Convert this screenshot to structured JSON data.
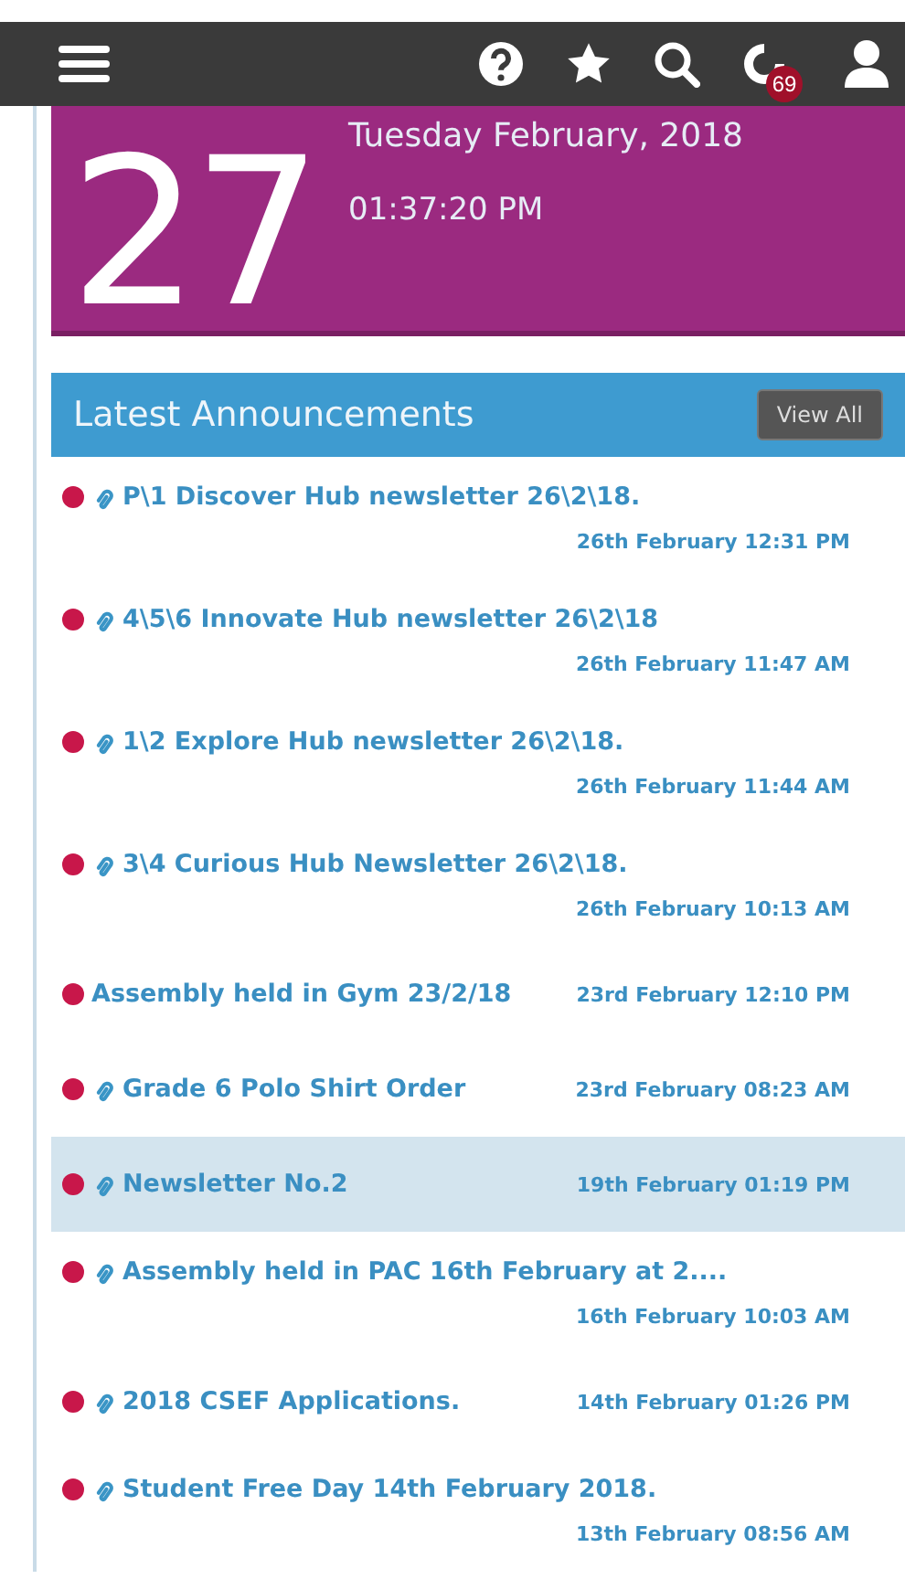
{
  "top_bar": {
    "notification_count": "69"
  },
  "date_card": {
    "day": "27",
    "date": "Tuesday February, 2018",
    "time": "01:37:20 PM"
  },
  "announcements": {
    "title": "Latest Announcements",
    "view_all": "View All",
    "items": [
      {
        "title": "P\\1 Discover Hub newsletter 26\\2\\18.",
        "date": "26th February 12:31 PM",
        "attachment": true,
        "selected": false
      },
      {
        "title": "4\\5\\6 Innovate Hub newsletter 26\\2\\18",
        "date": "26th February 11:47 AM",
        "attachment": true,
        "selected": false
      },
      {
        "title": "1\\2 Explore Hub newsletter 26\\2\\18.",
        "date": "26th February 11:44 AM",
        "attachment": true,
        "selected": false
      },
      {
        "title": "3\\4 Curious Hub Newsletter 26\\2\\18.",
        "date": "26th February 10:13 AM",
        "attachment": true,
        "selected": false
      },
      {
        "title": "Assembly held in Gym 23/2/18",
        "date": "23rd February 12:10 PM",
        "attachment": false,
        "selected": false
      },
      {
        "title": "Grade 6 Polo Shirt Order",
        "date": "23rd February 08:23 AM",
        "attachment": true,
        "selected": false
      },
      {
        "title": "Newsletter No.2",
        "date": "19th February 01:19 PM",
        "attachment": true,
        "selected": true
      },
      {
        "title": "Assembly held in PAC 16th February at 2....",
        "date": "16th February 10:03 AM",
        "attachment": true,
        "selected": false
      },
      {
        "title": "2018 CSEF Applications.",
        "date": "14th February 01:26 PM",
        "attachment": true,
        "selected": false
      },
      {
        "title": "Student Free Day 14th February 2018.",
        "date": "13th February 08:56 AM",
        "attachment": true,
        "selected": false
      }
    ]
  }
}
